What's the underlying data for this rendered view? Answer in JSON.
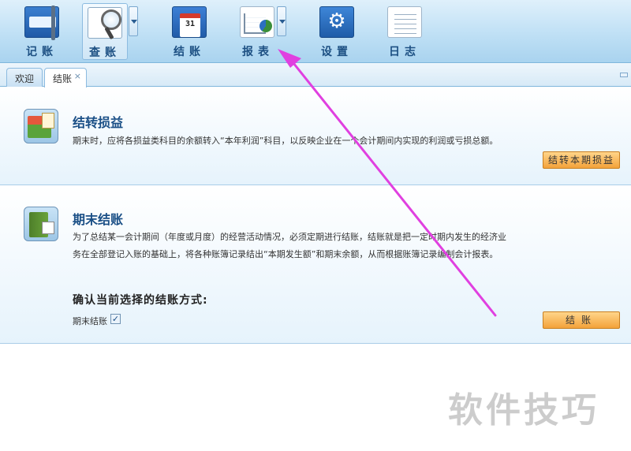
{
  "toolbar": {
    "buttons": [
      {
        "label": "记账",
        "icon": "ledger-icon"
      },
      {
        "label": "查账",
        "icon": "search-icon"
      },
      {
        "label": "结账",
        "icon": "calendar-icon"
      },
      {
        "label": "报表",
        "icon": "report-chart-icon"
      },
      {
        "label": "设置",
        "icon": "gear-icon"
      },
      {
        "label": "日志",
        "icon": "log-icon"
      }
    ],
    "calendar_number": "31"
  },
  "tabs": {
    "welcome": "欢迎",
    "current": "结账",
    "close_glyph": "×"
  },
  "panel1": {
    "title": "结转损益",
    "description": "期末时，应将各损益类科目的余额转入“本年利润”科目，以反映企业在一个会计期间内实现的利润或亏损总额。",
    "button": "结转本期损益"
  },
  "panel2": {
    "title": "期末结账",
    "description_line1": "为了总结某一会计期间（年度或月度）的经营活动情况，必须定期进行结账，结账就是把一定时期内发生的经济业",
    "description_line2": "务在全部登记入账的基础上，将各种账簿记录结出“本期发生额”和期末余额，从而根据账簿记录编制会计报表。",
    "confirm_title": "确认当前选择的结账方式:",
    "checkbox_label": "期末结账",
    "checkbox_checked": true,
    "checkbox_glyph": "✓",
    "button": "结账"
  },
  "watermark": "软件技巧",
  "colors": {
    "accent": "#1a4f86",
    "annotation_arrow": "#e040e0",
    "button_orange": "#f3a23a"
  }
}
